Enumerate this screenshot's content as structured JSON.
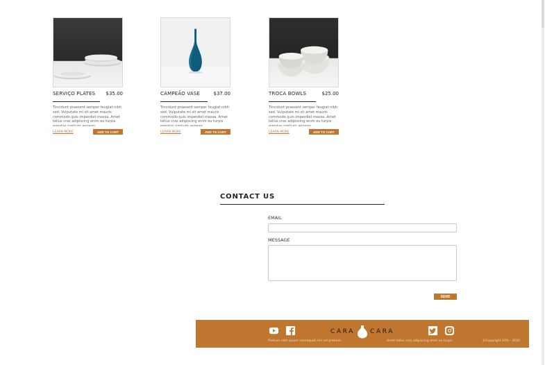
{
  "products": [
    {
      "name": "SERVIÇO PLATES",
      "price": "$35.00",
      "image": "stacked-plates-dark-photo",
      "description": "Tincidunt praesent semper feugiat nibh sed. Vulputate mi sit amet mauris commodo quis imperdiet massa. Amet tellus cras adipiscing enim eu turpis egestas pretium aenean.",
      "learn_label": "LEARN MORE",
      "cart_label": "ADD TO CART"
    },
    {
      "name": "CAMPEÃO VASE",
      "price": "$37.00",
      "image": "blue-vase-photo",
      "description": "Tincidunt praesent semper feugiat nibh sed. Vulputate mi sit amet mauris commodo quis imperdiet massa. Amet tellus cras adipiscing enim eu turpis egestas pretium aenean.",
      "learn_label": "LEARN MORE",
      "cart_label": "ADD TO CART"
    },
    {
      "name": "TROCA BOWLS",
      "price": "$25.00",
      "image": "stacked-bowls-photo",
      "description": "Tincidunt praesent semper feugiat nibh sed. Vulputate mi sit amet mauris commodo quis imperdiet massa. Amet tellus cras adipiscing enim eu turpis egestas pretium aenean.",
      "learn_label": "LEARN MORE",
      "cart_label": "ADD TO CART"
    }
  ],
  "contact": {
    "title": "CONTACT US",
    "email_label": "EMAIL",
    "email_value": "",
    "message_label": "MESSAGE",
    "message_value": "",
    "send_label": "SEND"
  },
  "footer": {
    "brand_left": "CARA",
    "brand_right": "CARA",
    "text_left": "Pretium nibh ipsum consequat nisl vel pretium",
    "text_right": "Amet tellus cras adipiscing enim eu turpis",
    "copyright": "©Copyright 20% - 2020",
    "icons": [
      "youtube-icon",
      "facebook-icon",
      "twitter-icon",
      "instagram-icon"
    ]
  },
  "colors": {
    "accent": "#c0762f",
    "text": "#222222",
    "muted": "#666666",
    "bowl-teal": "#0f5b7a"
  }
}
